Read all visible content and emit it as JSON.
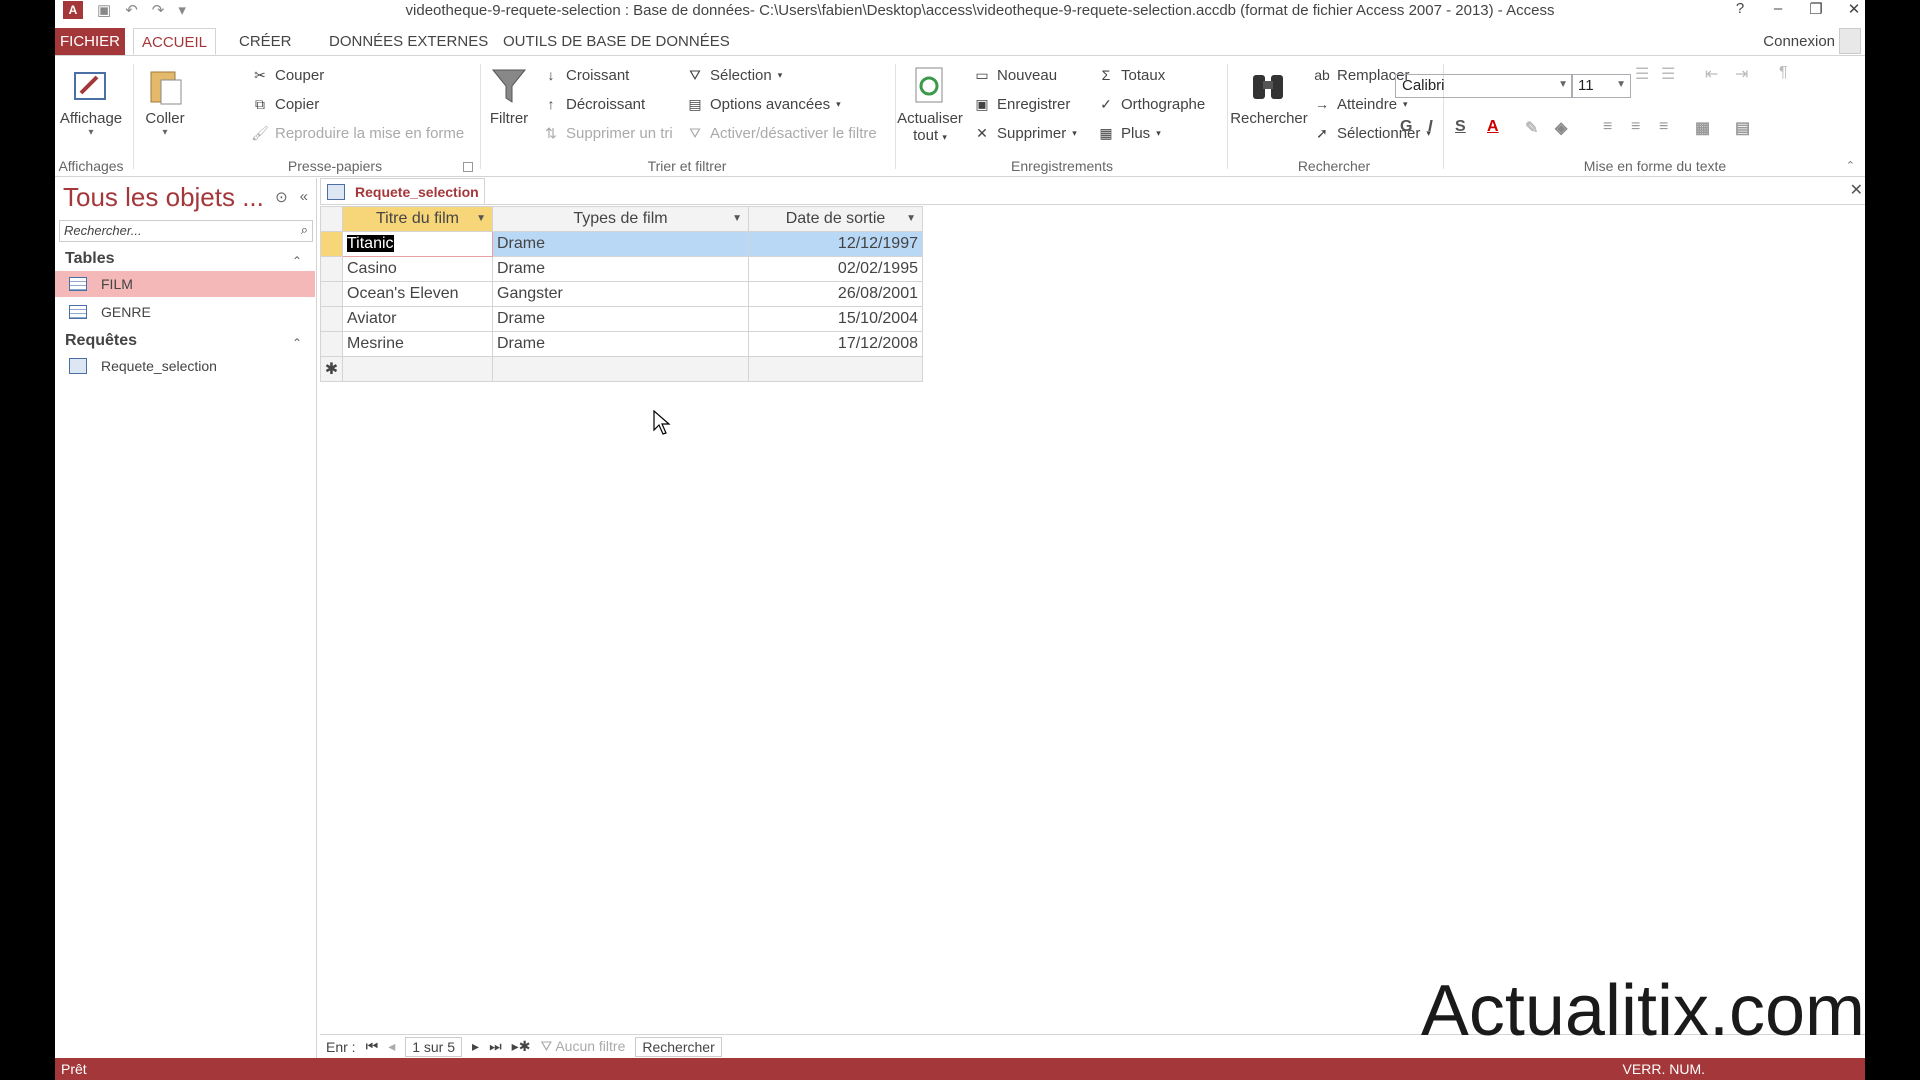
{
  "window": {
    "title": "videotheque-9-requete-selection : Base de données- C:\\Users\\fabien\\Desktop\\access\\videotheque-9-requete-selection.accdb (format de fichier Access 2007 - 2013) - Access",
    "app_icon": "A",
    "help": "?",
    "minimize": "–",
    "restore": "❐",
    "close": "✕"
  },
  "tabs": [
    "FICHIER",
    "ACCUEIL",
    "CRÉER",
    "DONNÉES EXTERNES",
    "OUTILS DE BASE DE DONNÉES"
  ],
  "connexion": "Connexion",
  "ribbon": {
    "affichages": {
      "label": "Affichages",
      "affichage": "Affichage"
    },
    "presse_papiers": {
      "label": "Presse-papiers",
      "coller": "Coller",
      "couper": "Couper",
      "copier": "Copier",
      "reproduire": "Reproduire la mise en forme"
    },
    "trier": {
      "label": "Trier et filtrer",
      "filtrer": "Filtrer",
      "croissant": "Croissant",
      "decroissant": "Décroissant",
      "supprimer_tri": "Supprimer un tri",
      "selection": "Sélection",
      "options": "Options avancées",
      "activer": "Activer/désactiver le filtre"
    },
    "enregistrements": {
      "label": "Enregistrements",
      "actualiser": "Actualiser",
      "tout": "tout",
      "nouveau": "Nouveau",
      "enregistrer": "Enregistrer",
      "supprimer": "Supprimer",
      "totaux": "Totaux",
      "orthographe": "Orthographe",
      "plus": "Plus"
    },
    "rechercher": {
      "label": "Rechercher",
      "rechercher": "Rechercher",
      "remplacer": "Remplacer",
      "atteindre": "Atteindre",
      "selectionner": "Sélectionner"
    },
    "mise_en_forme": {
      "label": "Mise en forme du texte",
      "font": "Calibri",
      "size": "11",
      "bold": "G",
      "italic": "I",
      "underline": "S"
    }
  },
  "nav": {
    "title": "Tous les objets ...",
    "search_placeholder": "Rechercher...",
    "tables_label": "Tables",
    "tables": [
      "FILM",
      "GENRE"
    ],
    "queries_label": "Requêtes",
    "queries": [
      "Requete_selection"
    ]
  },
  "document": {
    "tab_label": "Requete_selection",
    "columns": [
      "Titre du film",
      "Types de film",
      "Date de sortie"
    ],
    "rows": [
      [
        "Titanic",
        "Drame",
        "12/12/1997"
      ],
      [
        "Casino",
        "Drame",
        "02/02/1995"
      ],
      [
        "Ocean's Eleven",
        "Gangster",
        "26/08/2001"
      ],
      [
        "Aviator",
        "Drame",
        "15/10/2004"
      ],
      [
        "Mesrine",
        "Drame",
        "17/12/2008"
      ]
    ],
    "new_row_marker": "✱"
  },
  "record_nav": {
    "label": "Enr :",
    "position": "1 sur 5",
    "filter": "Aucun filtre",
    "search": "Rechercher"
  },
  "status": {
    "left": "Prêt",
    "right": "VERR. NUM."
  },
  "watermark": "Actualitix.com",
  "colors": {
    "accent": "#a4373a",
    "active_header": "#f7d67a",
    "selected_nav": "#f4b8b9"
  }
}
